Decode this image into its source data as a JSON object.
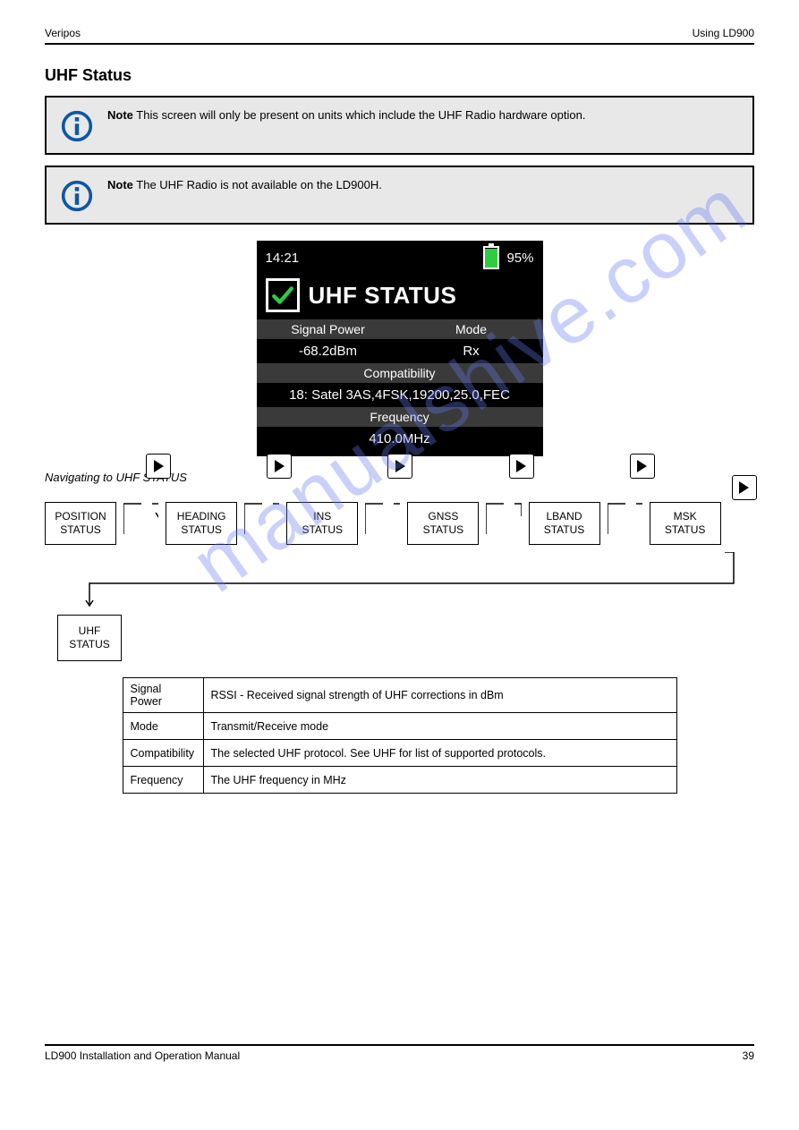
{
  "header": {
    "left": "Veripos",
    "right": "Using LD900"
  },
  "section_title": "UHF Status",
  "note1": {
    "label": "Note",
    "text": " This screen will only be present on units which include the UHF Radio hardware option."
  },
  "note2": {
    "label": "Note",
    "text": " The UHF Radio is not available on the LD900H."
  },
  "device": {
    "time": "14:21",
    "battery_pct": "95%",
    "title": "UHF STATUS",
    "row_heads": [
      "Signal Power",
      "Mode"
    ],
    "row_vals": [
      "-68.2dBm",
      "Rx"
    ],
    "compat_head": "Compatibility",
    "compat_val": "18: Satel 3AS,4FSK,19200,25.0,FEC",
    "freq_head": "Frequency",
    "freq_val": "410.0MHz"
  },
  "nav_title": "Navigating to UHF STATUS",
  "flow_row1": [
    "POSITION STATUS",
    "HEADING STATUS",
    "INS STATUS",
    "GNSS STATUS",
    "LBAND STATUS",
    "MSK STATUS"
  ],
  "flow_row2": [
    "UHF STATUS"
  ],
  "table": {
    "rows": [
      {
        "label": "Signal Power",
        "desc": "RSSI - Received signal strength of UHF corrections in dBm"
      },
      {
        "label": "Mode",
        "desc": "Transmit/Receive mode"
      },
      {
        "label": "Compatibility",
        "desc": "The selected UHF protocol. See UHF   for list of supported protocols."
      },
      {
        "label": "Frequency",
        "desc": "The UHF frequency in MHz"
      }
    ]
  },
  "footer": {
    "left": "LD900 Installation and Operation Manual",
    "right": "39"
  },
  "watermark": "manualshive.com"
}
